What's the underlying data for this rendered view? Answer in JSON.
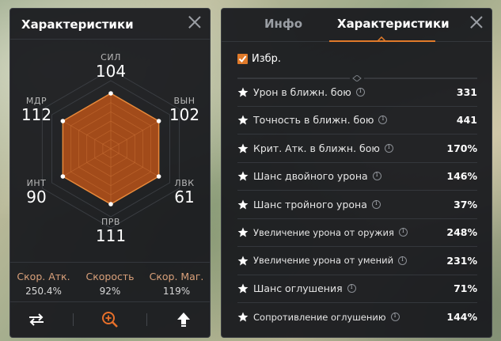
{
  "left_panel": {
    "title": "Характеристики",
    "radar": {
      "stats": [
        {
          "label": "СИЛ",
          "value": "104"
        },
        {
          "label": "ВЫН",
          "value": "102"
        },
        {
          "label": "ЛВК",
          "value": "61"
        },
        {
          "label": "ПРВ",
          "value": "111"
        },
        {
          "label": "ИНТ",
          "value": "90"
        },
        {
          "label": "МДР",
          "value": "112"
        }
      ],
      "fill_color": "#b0501a",
      "stroke_color": "#e8893a"
    },
    "speeds": [
      {
        "label": "Скор. Атк.",
        "value": "250.4%"
      },
      {
        "label": "Скорость",
        "value": "92%"
      },
      {
        "label": "Скор. Маг.",
        "value": "119%"
      }
    ]
  },
  "right_panel": {
    "tabs": [
      {
        "label": "Инфо"
      },
      {
        "label": "Характеристики"
      }
    ],
    "favorites_label": "Избр.",
    "stats": [
      {
        "name": "Урон в ближн. бою",
        "value": "331"
      },
      {
        "name": "Точность в ближн. бою",
        "value": "441"
      },
      {
        "name": "Крит. Атк. в ближн. бою",
        "value": "170%"
      },
      {
        "name": "Шанс двойного урона",
        "value": "146%"
      },
      {
        "name": "Шанс тройного урона",
        "value": "37%"
      },
      {
        "name": "Увеличение урона от оружия",
        "value": "248%"
      },
      {
        "name": "Увеличение урона от умений",
        "value": "231%"
      },
      {
        "name": "Шанс оглушения",
        "value": "71%"
      },
      {
        "name": "Сопротивление оглушению",
        "value": "144%"
      }
    ]
  },
  "colors": {
    "accent": "#e07a2a",
    "speed_label": "#d9a07a"
  }
}
